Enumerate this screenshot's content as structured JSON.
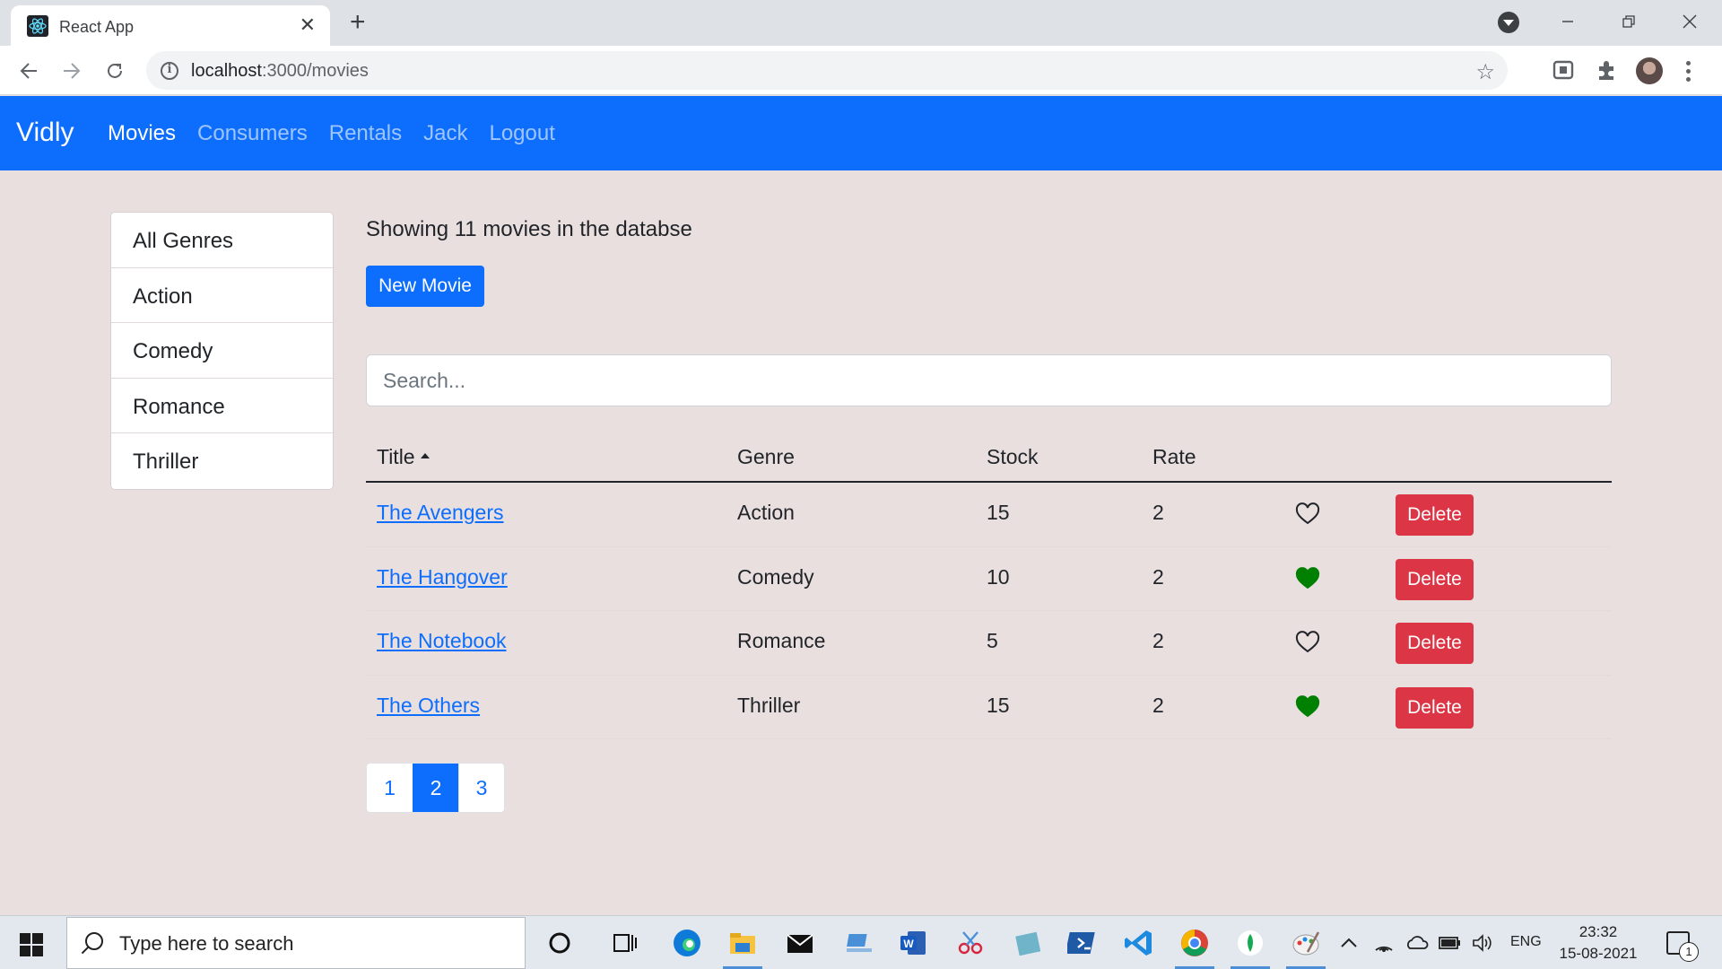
{
  "browser": {
    "tab_title": "React App",
    "url_host": "localhost",
    "url_path": ":3000/movies"
  },
  "navbar": {
    "brand": "Vidly",
    "links": [
      {
        "label": "Movies",
        "active": true
      },
      {
        "label": "Consumers",
        "active": false
      },
      {
        "label": "Rentals",
        "active": false
      },
      {
        "label": "Jack",
        "active": false
      },
      {
        "label": "Logout",
        "active": false
      }
    ]
  },
  "genres": [
    "All Genres",
    "Action",
    "Comedy",
    "Romance",
    "Thriller"
  ],
  "main": {
    "count_text": "Showing 11 movies in the databse",
    "new_movie_label": "New Movie",
    "search_placeholder": "Search..."
  },
  "table": {
    "columns": [
      "Title",
      "Genre",
      "Stock",
      "Rate"
    ],
    "sorted_column": "Title",
    "sort_direction": "asc",
    "delete_label": "Delete",
    "rows": [
      {
        "title": "The Avengers",
        "genre": "Action",
        "stock": "15",
        "rate": "2",
        "liked": false
      },
      {
        "title": "The Hangover",
        "genre": "Comedy",
        "stock": "10",
        "rate": "2",
        "liked": true
      },
      {
        "title": "The Notebook",
        "genre": "Romance",
        "stock": "5",
        "rate": "2",
        "liked": false
      },
      {
        "title": "The Others",
        "genre": "Thriller",
        "stock": "15",
        "rate": "2",
        "liked": true
      }
    ]
  },
  "pagination": {
    "pages": [
      "1",
      "2",
      "3"
    ],
    "current": "2"
  },
  "taskbar": {
    "search_text": "Type here to search",
    "language": "ENG",
    "time": "23:32",
    "date": "15-08-2021",
    "notification_count": "1"
  },
  "colors": {
    "primary": "#0d6efd",
    "danger": "#dc3545",
    "liked": "#008000",
    "page_bg": "#e9dfdf"
  }
}
